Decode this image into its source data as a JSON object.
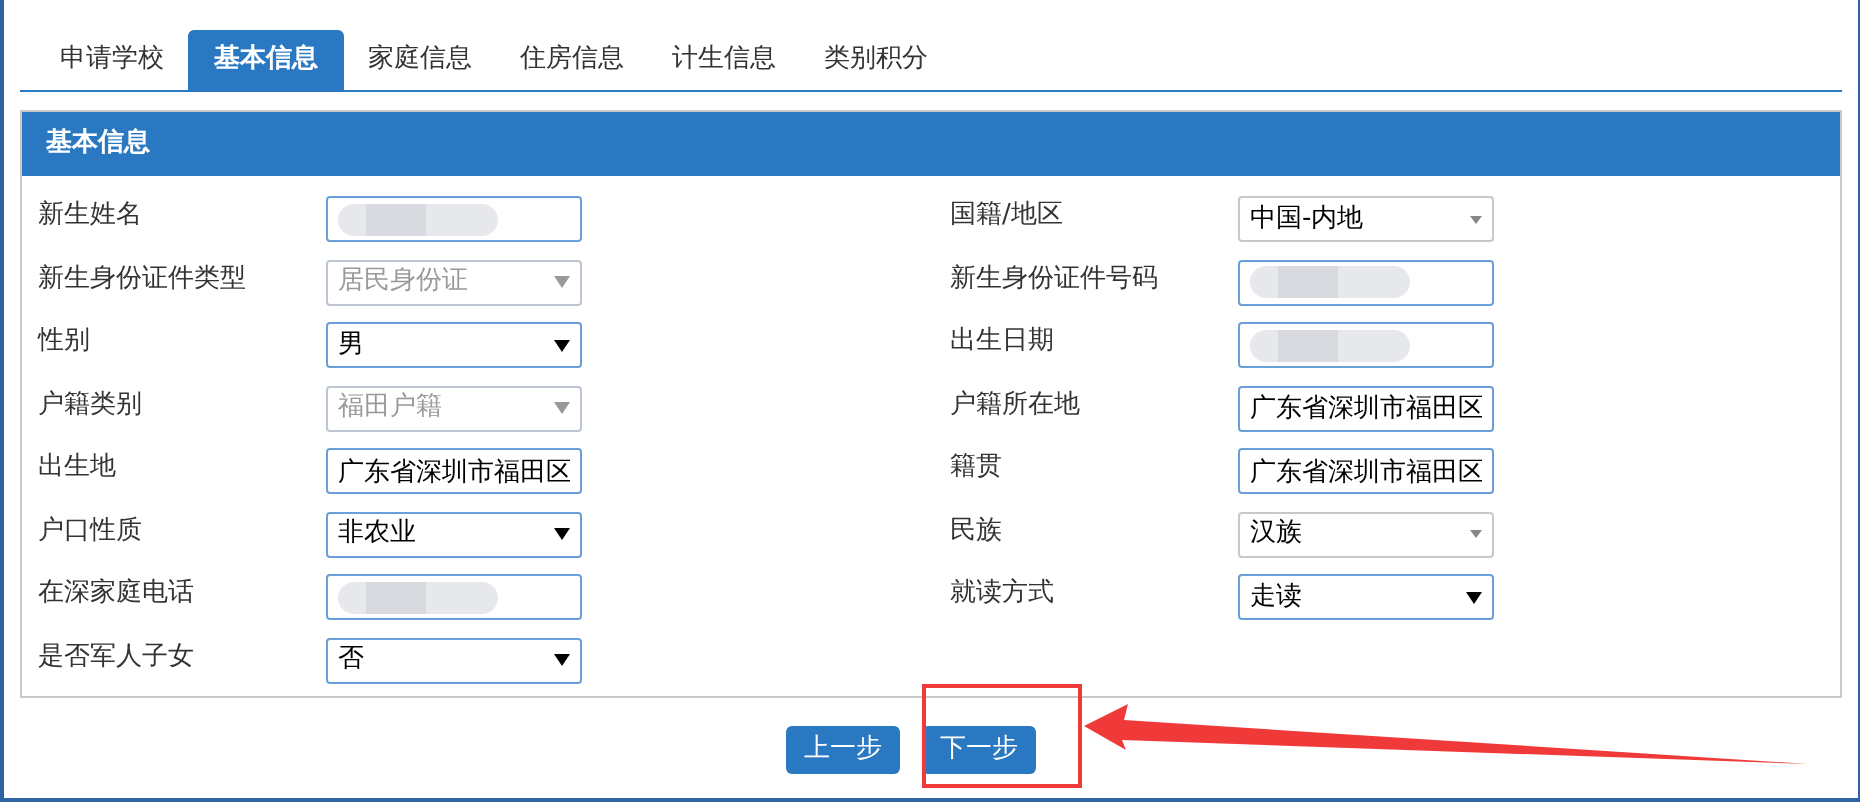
{
  "tabs": [
    {
      "label": "申请学校",
      "selected": false
    },
    {
      "label": "基本信息",
      "selected": true
    },
    {
      "label": "家庭信息",
      "selected": false
    },
    {
      "label": "住房信息",
      "selected": false
    },
    {
      "label": "计生信息",
      "selected": false
    },
    {
      "label": "类别积分",
      "selected": false
    }
  ],
  "panel": {
    "title": "基本信息",
    "left_fields": [
      {
        "label": "新生姓名",
        "kind": "masked"
      },
      {
        "label": "新生身份证件类型",
        "kind": "select",
        "value": "居民身份证",
        "disabled": true
      },
      {
        "label": "性别",
        "kind": "select",
        "value": "男",
        "disabled": false
      },
      {
        "label": "户籍类别",
        "kind": "select",
        "value": "福田户籍",
        "disabled": true
      },
      {
        "label": "出生地",
        "kind": "text",
        "value": "广东省深圳市福田区"
      },
      {
        "label": "户口性质",
        "kind": "select",
        "value": "非农业",
        "disabled": false
      },
      {
        "label": "在深家庭电话",
        "kind": "masked"
      },
      {
        "label": "是否军人子女",
        "kind": "select",
        "value": "否",
        "disabled": false
      }
    ],
    "right_fields": [
      {
        "label": "国籍/地区",
        "kind": "combo",
        "value": "中国-内地"
      },
      {
        "label": "新生身份证件号码",
        "kind": "masked"
      },
      {
        "label": "出生日期",
        "kind": "masked"
      },
      {
        "label": "户籍所在地",
        "kind": "text",
        "value": "广东省深圳市福田区"
      },
      {
        "label": "籍贯",
        "kind": "text",
        "value": "广东省深圳市福田区"
      },
      {
        "label": "民族",
        "kind": "combo",
        "value": "汉族"
      },
      {
        "label": "就读方式",
        "kind": "select",
        "value": "走读",
        "disabled": false
      }
    ]
  },
  "buttons": [
    "上一步",
    "下一步"
  ]
}
